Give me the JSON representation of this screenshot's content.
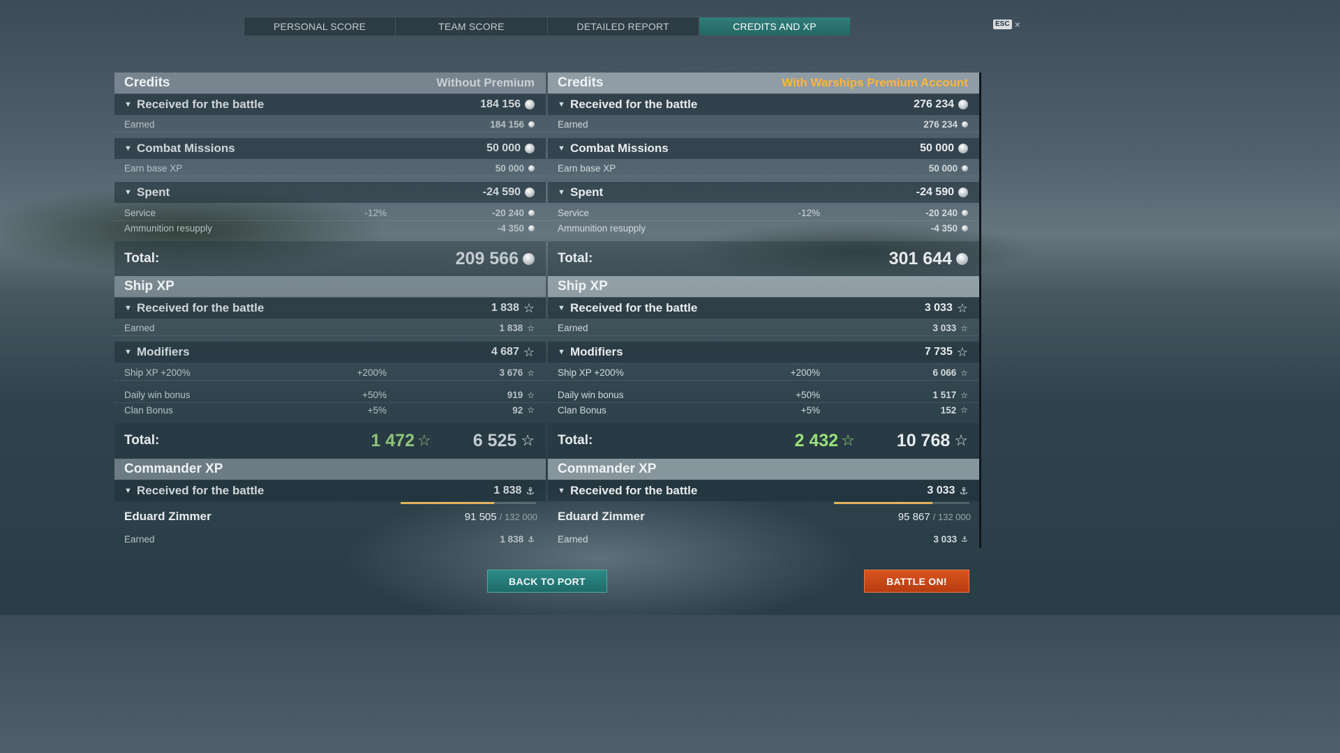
{
  "tabs": [
    "PERSONAL SCORE",
    "TEAM SCORE",
    "DETAILED REPORT",
    "CREDITS AND XP"
  ],
  "esc": {
    "key": "ESC",
    "close": "×"
  },
  "colors": {
    "premium_accent": "#ffb43a",
    "active_tab": "#2f7d7a",
    "back_button": "#2b8a87",
    "battle_button": "#d9541f",
    "xp_green": "#9be07a"
  },
  "icons": {
    "credits": "silver-coin-icon",
    "xp": "star-icon",
    "commander_xp": "anchor-icon"
  },
  "left": {
    "credits_title": "Credits",
    "mode": "Without Premium",
    "received_label": "Received for the battle",
    "received_value": "184 156",
    "earned_label": "Earned",
    "earned_value": "184 156",
    "combat_label": "Combat Missions",
    "combat_value": "50 000",
    "base_xp_label": "Earn base XP",
    "base_xp_value": "50 000",
    "spent_label": "Spent",
    "spent_value": "-24 590",
    "service_label": "Service",
    "service_pct": "-12%",
    "service_value": "-20 240",
    "ammo_label": "Ammunition resupply",
    "ammo_value": "-4 350",
    "total_label": "Total:",
    "credits_total": "209 566",
    "shipxp_title": "Ship XP",
    "xp_received_label": "Received for the battle",
    "xp_received_value": "1 838",
    "xp_earned_label": "Earned",
    "xp_earned_value": "1 838",
    "modifiers_label": "Modifiers",
    "modifiers_value": "4 687",
    "shipxp_mod_label": "Ship XP +200%",
    "shipxp_mod_pct": "+200%",
    "shipxp_mod_value": "3 676",
    "daily_label": "Daily win bonus",
    "daily_pct": "+50%",
    "daily_value": "919",
    "clan_label": "Clan Bonus",
    "clan_pct": "+5%",
    "clan_value": "92",
    "xp_total_label": "Total:",
    "xp_total_green": "1 472",
    "xp_total": "6 525",
    "cmdxp_title": "Commander XP",
    "cmd_received_label": "Received for the battle",
    "cmd_received_value": "1 838",
    "commander_name": "Eduard Zimmer",
    "commander_xp": "91 505",
    "commander_xp_max": "/ 132 000",
    "commander_progress": 0.693,
    "cmd_earned_label": "Earned",
    "cmd_earned_value": "1 838"
  },
  "right": {
    "credits_title": "Credits",
    "mode": "With Warships Premium Account",
    "received_label": "Received for the battle",
    "received_value": "276 234",
    "earned_label": "Earned",
    "earned_value": "276 234",
    "combat_label": "Combat Missions",
    "combat_value": "50 000",
    "base_xp_label": "Earn base XP",
    "base_xp_value": "50 000",
    "spent_label": "Spent",
    "spent_value": "-24 590",
    "service_label": "Service",
    "service_pct": "-12%",
    "service_value": "-20 240",
    "ammo_label": "Ammunition resupply",
    "ammo_value": "-4 350",
    "total_label": "Total:",
    "credits_total": "301 644",
    "shipxp_title": "Ship XP",
    "xp_received_label": "Received for the battle",
    "xp_received_value": "3 033",
    "xp_earned_label": "Earned",
    "xp_earned_value": "3 033",
    "modifiers_label": "Modifiers",
    "modifiers_value": "7 735",
    "shipxp_mod_label": "Ship XP +200%",
    "shipxp_mod_pct": "+200%",
    "shipxp_mod_value": "6 066",
    "daily_label": "Daily win bonus",
    "daily_pct": "+50%",
    "daily_value": "1 517",
    "clan_label": "Clan Bonus",
    "clan_pct": "+5%",
    "clan_value": "152",
    "xp_total_label": "Total:",
    "xp_total_green": "2 432",
    "xp_total": "10 768",
    "cmdxp_title": "Commander XP",
    "cmd_received_label": "Received for the battle",
    "cmd_received_value": "3 033",
    "commander_name": "Eduard Zimmer",
    "commander_xp": "95 867",
    "commander_xp_max": "/ 132 000",
    "commander_progress": 0.726,
    "cmd_earned_label": "Earned",
    "cmd_earned_value": "3 033"
  },
  "buttons": {
    "back": "BACK TO PORT",
    "battle": "BATTLE ON!"
  }
}
